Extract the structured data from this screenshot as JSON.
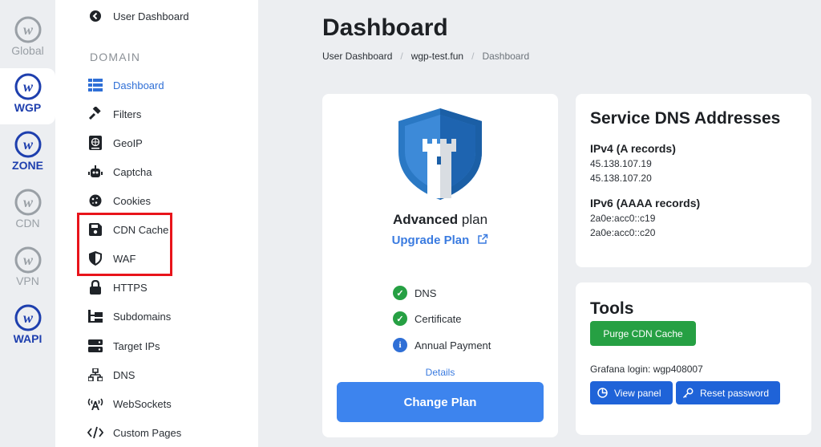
{
  "rail": [
    {
      "label": "Global",
      "style": "gray",
      "active": false
    },
    {
      "label": "WGP",
      "style": "blue",
      "active": true
    },
    {
      "label": "ZONE",
      "style": "blue",
      "active": false
    },
    {
      "label": "CDN",
      "style": "gray",
      "active": false
    },
    {
      "label": "VPN",
      "style": "gray",
      "active": false
    },
    {
      "label": "WAPI",
      "style": "blue",
      "active": false
    }
  ],
  "sidebar": {
    "back_label": "User Dashboard",
    "section_label": "DOMAIN",
    "items": [
      {
        "label": "Dashboard",
        "icon": "table-icon"
      },
      {
        "label": "Filters",
        "icon": "gavel-icon"
      },
      {
        "label": "GeoIP",
        "icon": "atlas-icon"
      },
      {
        "label": "Captcha",
        "icon": "robot-icon"
      },
      {
        "label": "Cookies",
        "icon": "cookie-icon"
      },
      {
        "label": "CDN Cache",
        "icon": "floppy-icon"
      },
      {
        "label": "WAF",
        "icon": "shield-icon"
      },
      {
        "label": "HTTPS",
        "icon": "lock-icon"
      },
      {
        "label": "Subdomains",
        "icon": "sitemap-icon"
      },
      {
        "label": "Target IPs",
        "icon": "server-icon"
      },
      {
        "label": "DNS",
        "icon": "network-icon"
      },
      {
        "label": "WebSockets",
        "icon": "broadcast-icon"
      },
      {
        "label": "Custom Pages",
        "icon": "code-icon"
      }
    ]
  },
  "header": {
    "title": "Dashboard",
    "breadcrumb": [
      "User Dashboard",
      "wgp-test.fun",
      "Dashboard"
    ]
  },
  "plan": {
    "name_bold": "Advanced",
    "name_rest": " plan",
    "upgrade_label": "Upgrade Plan",
    "features": [
      {
        "label": "DNS",
        "status": "ok"
      },
      {
        "label": "Certificate",
        "status": "ok"
      },
      {
        "label": "Annual Payment",
        "status": "info"
      }
    ],
    "details_label": "Details",
    "change_label": "Change Plan"
  },
  "dns": {
    "title": "Service DNS Addresses",
    "ipv4_label": "IPv4 (A records)",
    "ipv4": [
      "45.138.107.19",
      "45.138.107.20"
    ],
    "ipv6_label": "IPv6 (AAAA records)",
    "ipv6": [
      "2a0e:acc0::c19",
      "2a0e:acc0::c20"
    ]
  },
  "tools": {
    "title": "Tools",
    "purge_label": "Purge CDN Cache",
    "grafana_label": "Grafana login: wgp408007",
    "view_panel_label": "View panel",
    "reset_password_label": "Reset password"
  },
  "colors": {
    "accent": "#3d84ee",
    "success": "#26a043",
    "highlight": "#e8141b"
  }
}
